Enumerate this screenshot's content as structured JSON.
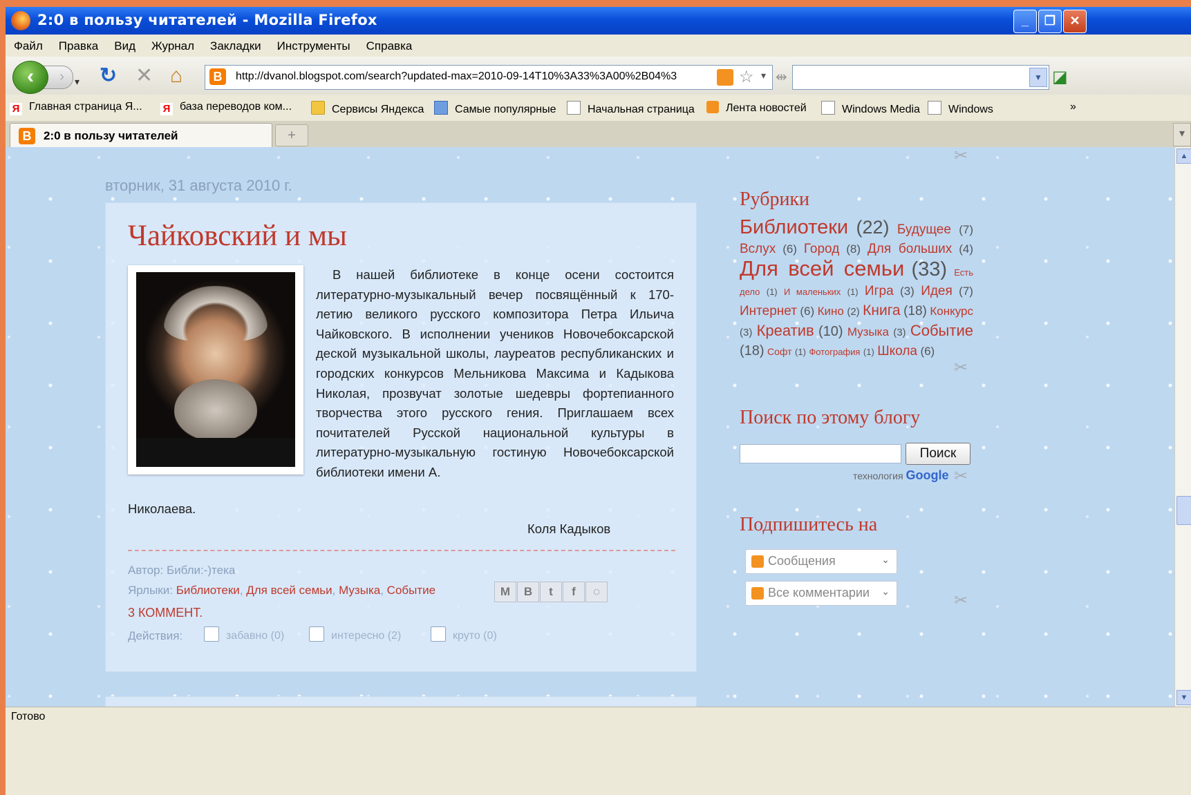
{
  "window": {
    "title": "2:0 в пользу читателей - Mozilla Firefox"
  },
  "menu": [
    "Файл",
    "Правка",
    "Вид",
    "Журнал",
    "Закладки",
    "Инструменты",
    "Справка"
  ],
  "address": {
    "url": "http://dvanol.blogspot.com/search?updated-max=2010-09-14T10%3A33%3A00%2B04%3"
  },
  "bookmarks": [
    "Главная страница Я...",
    "база переводов ком...",
    "Сервисы Яндекса",
    "Самые популярные",
    "Начальная страница",
    "Лента новостей",
    "Windows Media",
    "Windows"
  ],
  "tab": {
    "label": "2:0 в пользу читателей"
  },
  "post": {
    "date": "вторник, 31 августа 2010 г.",
    "title": "Чайковский и мы",
    "body": "В нашей библиотеке в конце осени состоится литературно-музыкальный вечер посвящённый к 170-летию великого русского композитора Петра Ильича Чайковского. В исполнении учеников Новочебоксарской деской музыкальной школы, лауреатов республиканских и городских конкурсов Мельникова Максима и Кадыкова Николая, прозвучат золотые шедевры фортепианного творчества этого русского гения. Приглашаем всех почитателей Русской национальной культуры в литературно-музыкальную гостиную Новочебоксарской библиотеки имени А.",
    "body_end": "Николаева.",
    "signature": "Коля Кадыков",
    "author_label": "Автор:",
    "author": "Библи:-)тека",
    "labels_label": "Ярлыки:",
    "labels": [
      "Библиотеки",
      "Для всей семьи",
      "Музыка",
      "Событие"
    ],
    "comments": "3 КОММЕНТ.",
    "actions_label": "Действия:",
    "actions": [
      "забавно (0)",
      "интересно (2)",
      "круто (0)"
    ]
  },
  "sidebar": {
    "categories_title": "Рубрики",
    "categories": [
      {
        "name": "Библиотеки",
        "count": "(22)",
        "size": 29
      },
      {
        "name": "Будущее",
        "count": "(7)",
        "size": 19
      },
      {
        "name": "Вслух",
        "count": "(6)",
        "size": 19
      },
      {
        "name": "Город",
        "count": "(8)",
        "size": 19
      },
      {
        "name": "Для больших",
        "count": "(4)",
        "size": 19
      },
      {
        "name": "Для всей семьи",
        "count": "(33)",
        "size": 31
      },
      {
        "name": "Есть дело",
        "count": "(1)",
        "size": 13
      },
      {
        "name": "И маленьких",
        "count": "(1)",
        "size": 13
      },
      {
        "name": "Игра",
        "count": "(3)",
        "size": 19
      },
      {
        "name": "Идея",
        "count": "(7)",
        "size": 19
      },
      {
        "name": "Интернет",
        "count": "(6)",
        "size": 19
      },
      {
        "name": "Кино",
        "count": "(2)",
        "size": 17
      },
      {
        "name": "Книга",
        "count": "(18)",
        "size": 21
      },
      {
        "name": "Конкурс",
        "count": "(3)",
        "size": 17
      },
      {
        "name": "Креатив",
        "count": "(10)",
        "size": 22
      },
      {
        "name": "Музыка",
        "count": "(3)",
        "size": 17
      },
      {
        "name": "Событие",
        "count": "(18)",
        "size": 22
      },
      {
        "name": "Софт",
        "count": "(1)",
        "size": 14
      },
      {
        "name": "Фотография",
        "count": "(1)",
        "size": 13
      },
      {
        "name": "Школа",
        "count": "(6)",
        "size": 19
      }
    ],
    "search_title": "Поиск по этому блогу",
    "search_button": "Поиск",
    "powered_by": "технология",
    "powered_brand": "Google",
    "subscribe_title": "Подпишитесь на",
    "subscribe": [
      "Сообщения",
      "Все комментарии"
    ]
  },
  "status": {
    "text": "Готово"
  }
}
